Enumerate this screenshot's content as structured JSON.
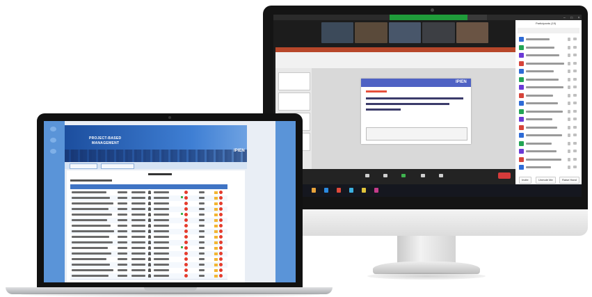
{
  "imac": {
    "zoom": {
      "participants_title": "Participants (19)",
      "panel_buttons": [
        "Invite",
        "Unmute Me",
        "Raise Hand"
      ],
      "slide": {
        "logo": "IPIEN"
      }
    }
  },
  "laptop": {
    "app": {
      "title_line1": "PROJECT-BASED",
      "title_line2": "MANAGEMENT",
      "logo": "IPIEN"
    }
  },
  "colors": {
    "zoom_green": "#1f9c3a",
    "end_red": "#d63b3b",
    "app_blue": "#3f74c4",
    "rail_blue": "#5a94d8"
  }
}
